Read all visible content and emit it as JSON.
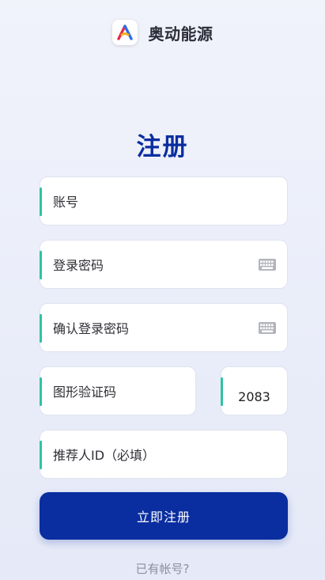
{
  "brand": {
    "app_name": "奥动能源",
    "logo_icon": "triangle-a-logo"
  },
  "title": "注册",
  "fields": {
    "account": {
      "placeholder": "账号"
    },
    "password": {
      "placeholder": "登录密码",
      "icon": "keyboard-icon"
    },
    "confirm_password": {
      "placeholder": "确认登录密码",
      "icon": "keyboard-icon"
    },
    "captcha": {
      "placeholder": "图形验证码",
      "code": "2083"
    },
    "referrer": {
      "placeholder": "推荐人ID（必填）"
    }
  },
  "submit_label": "立即注册",
  "login_prompt": "已有帐号?",
  "colors": {
    "primary": "#0a2ea0",
    "accent": "#2ec4a0"
  }
}
